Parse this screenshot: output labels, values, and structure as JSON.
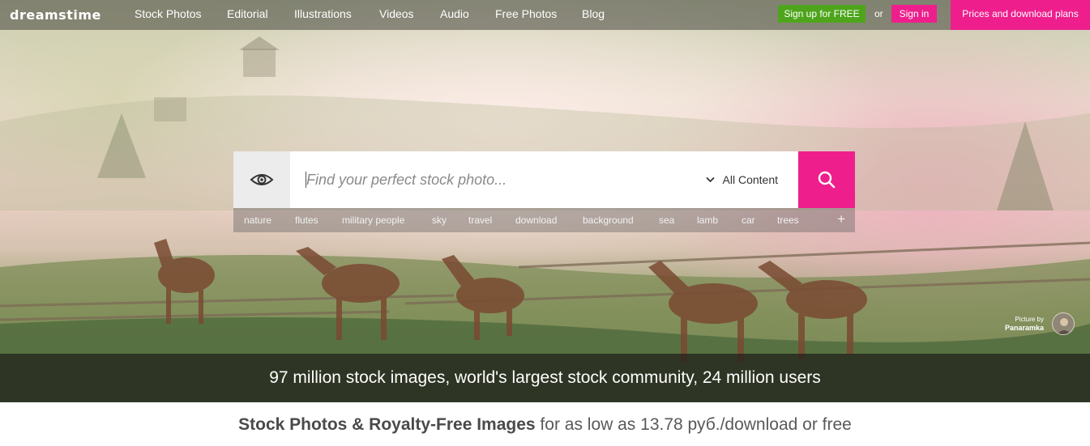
{
  "brand": {
    "logo_text": "dreamstime"
  },
  "nav": {
    "items": [
      "Stock Photos",
      "Editorial",
      "Illustrations",
      "Videos",
      "Audio",
      "Free Photos",
      "Blog"
    ],
    "signup_label": "Sign up for FREE",
    "or_label": "or",
    "signin_label": "Sign in",
    "prices_label": "Prices and download plans"
  },
  "search": {
    "placeholder": "Find your perfect stock photo...",
    "value": "",
    "content_filter": "All Content",
    "tags": [
      "nature",
      "flutes",
      "military people",
      "sky",
      "travel",
      "download",
      "background",
      "sea",
      "lamb",
      "car",
      "trees"
    ],
    "more_label": "+"
  },
  "credit": {
    "line1": "Picture by",
    "author": "Panaramka"
  },
  "banner": {
    "text": "97 million stock images, world's largest stock community, 24 million users"
  },
  "tagline": {
    "bold": "Stock Photos & Royalty-Free Images",
    "rest": " for as low as 13.78 руб./download or free"
  },
  "colors": {
    "accent_pink": "#ee1f8d",
    "signup_green": "#4ea51c"
  },
  "icons": {
    "eye": "eye-icon",
    "search": "search-icon",
    "chevron": "chevron-down-icon",
    "plus": "plus-icon"
  }
}
